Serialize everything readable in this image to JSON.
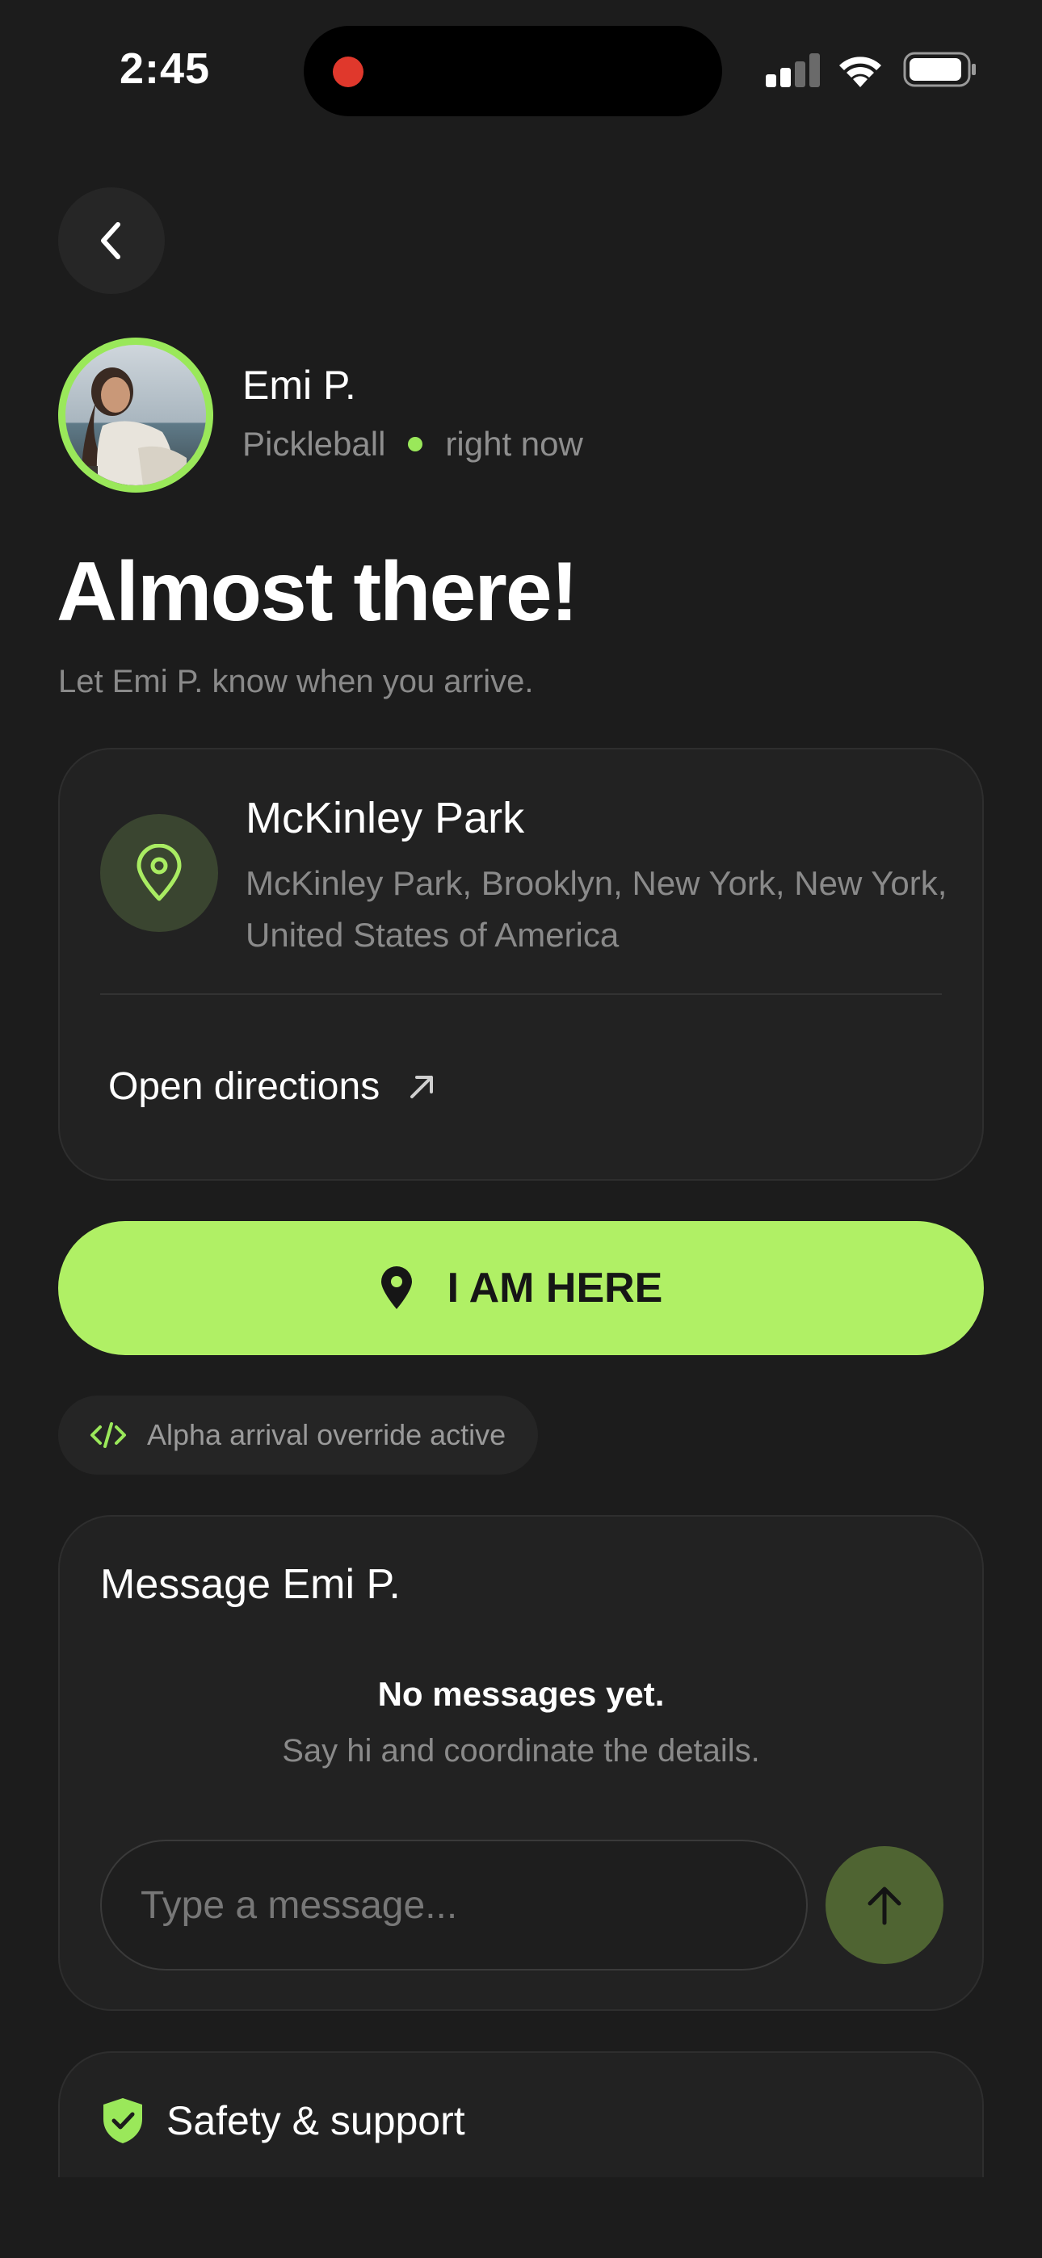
{
  "status_bar": {
    "time": "2:45",
    "recording_color": "#e0382c",
    "signal_icon": "signal-bars-icon",
    "wifi_icon": "wifi-icon",
    "battery_icon": "battery-icon"
  },
  "header": {
    "back_icon": "chevron-left-icon"
  },
  "profile": {
    "name": "Emi P.",
    "sport": "Pickleball",
    "timing": "right now",
    "accent": "#9ae85a"
  },
  "hero": {
    "headline": "Almost there!",
    "subtitle": "Let Emi P. know when you arrive."
  },
  "location": {
    "icon": "map-pin-icon",
    "name": "McKinley Park",
    "address": "McKinley Park, Brooklyn, New York, New York, United States of America",
    "directions_label": "Open directions",
    "directions_icon": "arrow-up-right-icon"
  },
  "arrival": {
    "button_label": "I AM HERE",
    "button_color": "#b0f065",
    "override_label": "Alpha arrival override active",
    "override_icon": "code-icon"
  },
  "messages": {
    "title": "Message Emi P.",
    "empty_title": "No messages yet.",
    "empty_subtitle": "Say hi and coordinate the details.",
    "input_placeholder": "Type a message...",
    "input_value": "",
    "send_icon": "arrow-up-icon"
  },
  "safety": {
    "label": "Safety & support",
    "icon": "shield-check-icon"
  }
}
